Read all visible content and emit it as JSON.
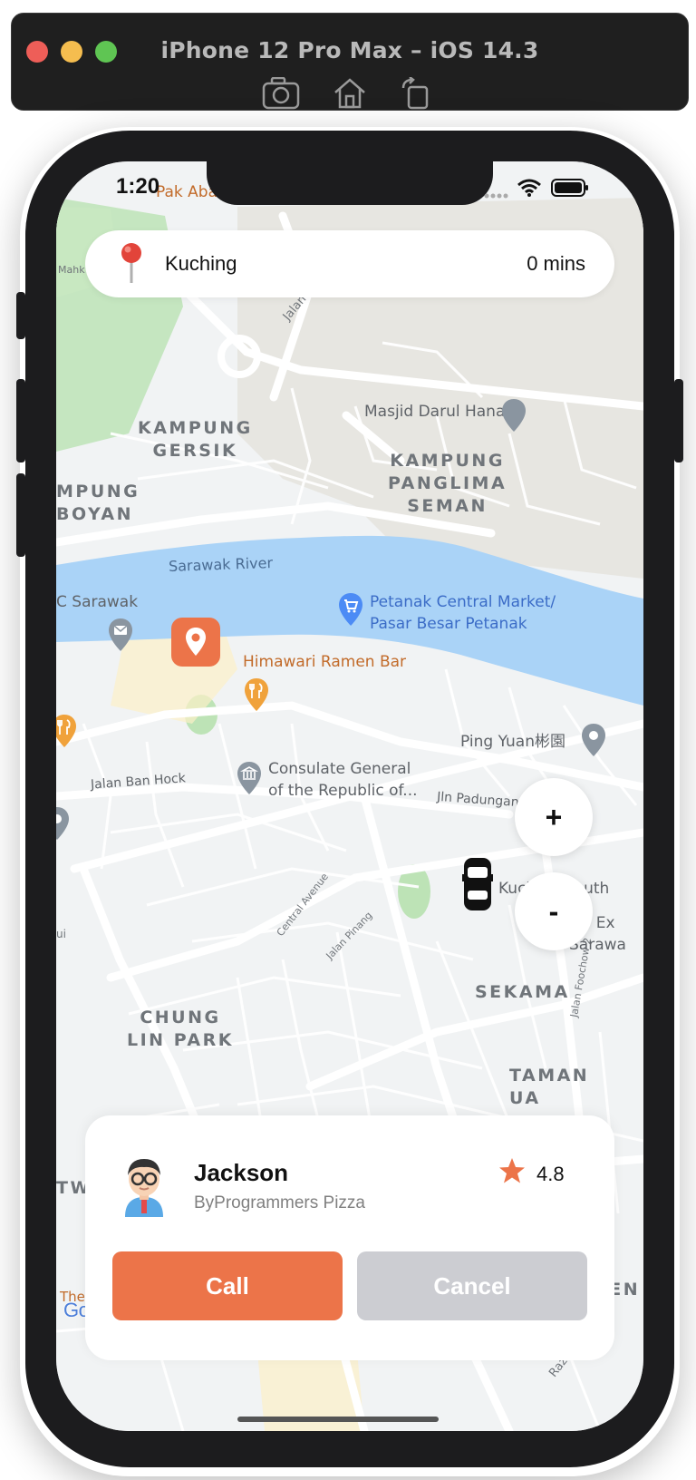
{
  "simulator": {
    "title": "iPhone 12 Pro Max – iOS 14.3",
    "colors": {
      "close": "#ee5e58",
      "minimize": "#f5bd4f",
      "zoom": "#5fc553"
    }
  },
  "status_bar": {
    "time": "1:20"
  },
  "location_bar": {
    "place": "Kuching",
    "eta": "0 mins"
  },
  "map": {
    "areas": {
      "kampung_gersik": "KAMPUNG\nGERSIK",
      "kampung_boyan": "MPUNG\nBOYAN",
      "kampung_panglima_seman": "KAMPUNG\nPANGLIMA\nSEMAN",
      "chung_lin_park": "CHUNG\nLIN PARK",
      "sekama": "SEKAMA",
      "taman_ua": "TAMAN\nUA",
      "tw": "TW",
      "den": "DEN"
    },
    "river": "Sarawak River",
    "pois": {
      "pak_aba": "Pak Aba Pata Mayang",
      "masjid": "Masjid Darul Hana",
      "sarawak": "C Sarawak",
      "petanak": "Petanak Central Market/\nPasar Besar Petanak",
      "himawari": "Himawari Ramen Bar",
      "ping_yuan": "Ping Yuan彬園",
      "consulate": "Consulate General\nof the Republic of...",
      "kuching_south": "Kuching South",
      "ex": "T Ex",
      "sarawa": "Sarawa",
      "mahk": "Mahk"
    },
    "roads": {
      "jalan_ban_hock": "Jalan Ban Hock",
      "jln_padungan": "Jln Padungan",
      "central_avenue": "Central Avenue",
      "jalan_pinang": "Jalan Pinang",
      "jalan_foochow": "Jalan Foochow 2",
      "jalan_top": "Jalan",
      "razak": "Razak",
      "ui": "ui"
    },
    "google_logo": "Google",
    "the_label": "The"
  },
  "zoom": {
    "in": "+",
    "out": "-"
  },
  "driver": {
    "name": "Jackson",
    "subtitle": "ByProgrammers Pizza",
    "rating": "4.8"
  },
  "actions": {
    "call": "Call",
    "cancel": "Cancel"
  },
  "colors": {
    "accent": "#ec7449",
    "cancel_bg": "#cccdd2",
    "star": "#ec7449",
    "water": "#aad3f7",
    "park": "#bde3b6",
    "map_bg": "#f1f3f4"
  }
}
